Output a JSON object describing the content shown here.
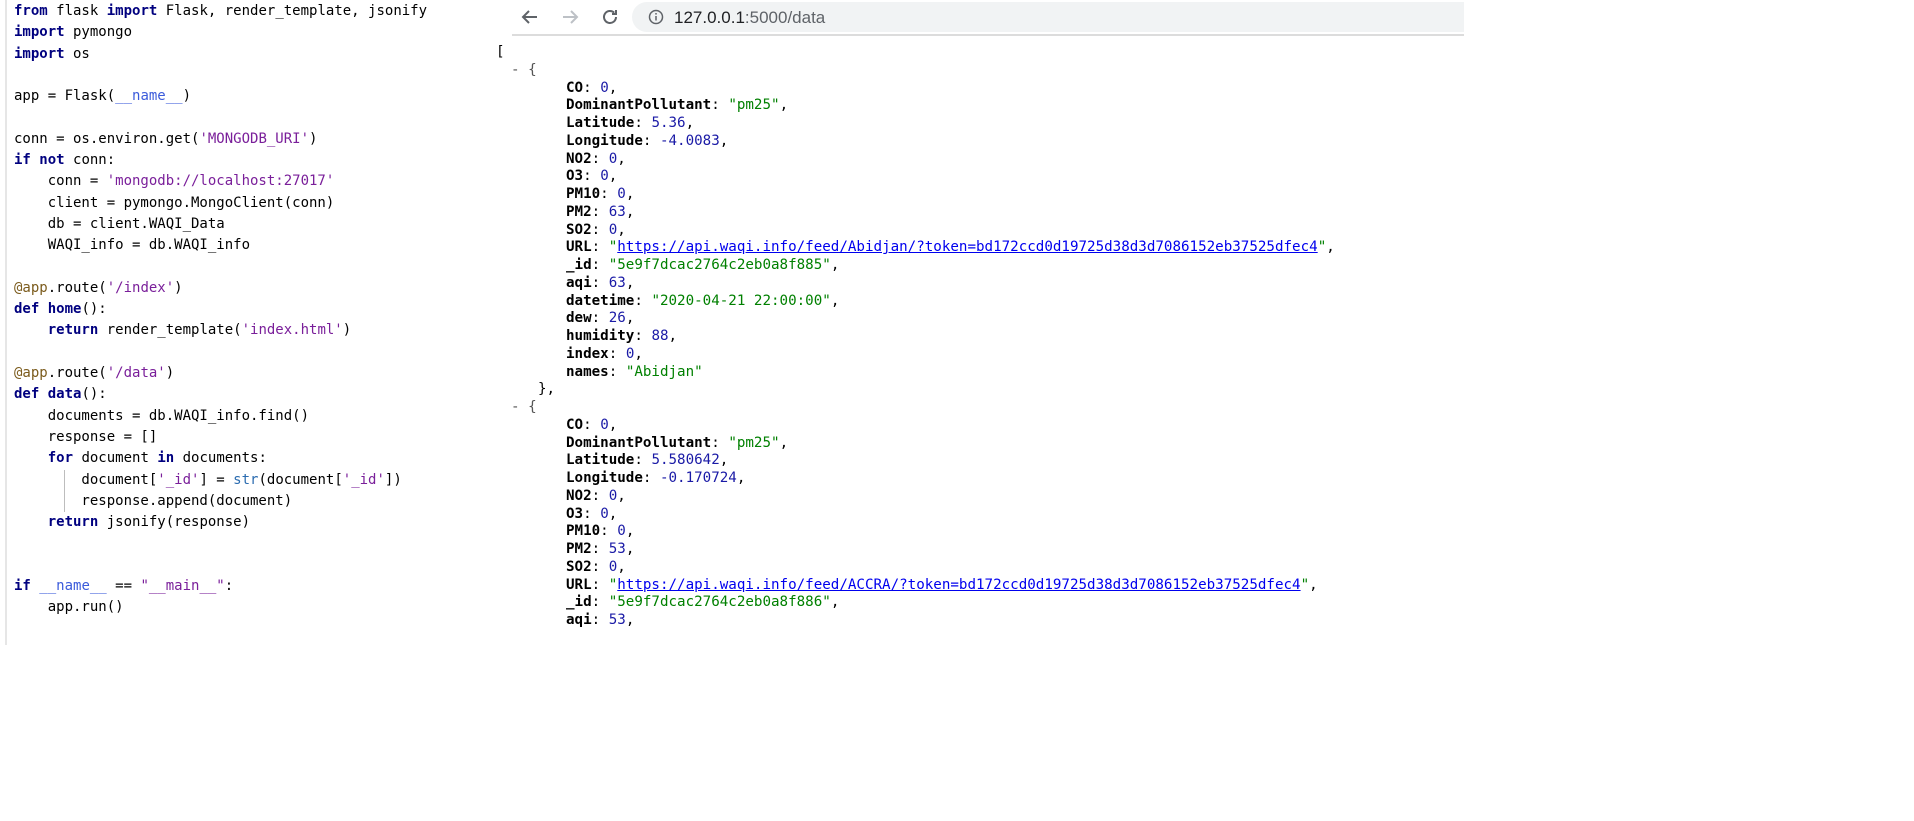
{
  "editor": {
    "lines": [
      [
        {
          "t": "from",
          "c": "kw2"
        },
        {
          "t": " flask "
        },
        {
          "t": "import",
          "c": "kw2"
        },
        {
          "t": " Flask, render_template, jsonify"
        }
      ],
      [
        {
          "t": "import",
          "c": "kw2"
        },
        {
          "t": " pymongo"
        }
      ],
      [
        {
          "t": "import",
          "c": "kw2"
        },
        {
          "t": " os"
        }
      ],
      [],
      [
        {
          "t": "app = Flask("
        },
        {
          "t": "__name__",
          "c": "dunder"
        },
        {
          "t": ")"
        }
      ],
      [],
      [
        {
          "t": "conn = os.environ.get("
        },
        {
          "t": "'MONGODB_URI'",
          "c": "strp"
        },
        {
          "t": ")"
        }
      ],
      [
        {
          "t": "if",
          "c": "kw2"
        },
        {
          "t": " "
        },
        {
          "t": "not",
          "c": "kw2"
        },
        {
          "t": " conn:"
        }
      ],
      [
        {
          "t": "    conn = "
        },
        {
          "t": "'mongodb://localhost:27017'",
          "c": "strp"
        }
      ],
      [
        {
          "t": "    client = pymongo.MongoClient(conn)"
        }
      ],
      [
        {
          "t": "    db = client.WAQI_Data"
        }
      ],
      [
        {
          "t": "    WAQI_info = db.WAQI_info"
        }
      ],
      [],
      [
        {
          "t": "@app",
          "c": "dec"
        },
        {
          "t": ".route("
        },
        {
          "t": "'/index'",
          "c": "strp"
        },
        {
          "t": ")"
        }
      ],
      [
        {
          "t": "def",
          "c": "kw2"
        },
        {
          "t": " "
        },
        {
          "t": "home",
          "c": "fn"
        },
        {
          "t": "():"
        }
      ],
      [
        {
          "t": "    "
        },
        {
          "t": "return",
          "c": "kw2"
        },
        {
          "t": " render_template("
        },
        {
          "t": "'index.html'",
          "c": "strp"
        },
        {
          "t": ")"
        }
      ],
      [],
      [
        {
          "t": "@app",
          "c": "dec"
        },
        {
          "t": ".route("
        },
        {
          "t": "'/data'",
          "c": "strp"
        },
        {
          "t": ")"
        }
      ],
      [
        {
          "t": "def",
          "c": "kw2"
        },
        {
          "t": " "
        },
        {
          "t": "data",
          "c": "fn"
        },
        {
          "t": "():"
        }
      ],
      [
        {
          "t": "    documents = db.WAQI_info.find()"
        }
      ],
      [
        {
          "t": "    response = []"
        }
      ],
      [
        {
          "t": "    "
        },
        {
          "t": "for",
          "c": "kw2"
        },
        {
          "t": " document "
        },
        {
          "t": "in",
          "c": "kw2"
        },
        {
          "t": " documents:"
        }
      ],
      [
        {
          "t": "        document["
        },
        {
          "t": "'_id'",
          "c": "strp"
        },
        {
          "t": "] = "
        },
        {
          "t": "str",
          "c": "builtin"
        },
        {
          "t": "(document["
        },
        {
          "t": "'_id'",
          "c": "strp"
        },
        {
          "t": "])"
        }
      ],
      [
        {
          "t": "        response.append(document)"
        }
      ],
      [
        {
          "t": "    "
        },
        {
          "t": "return",
          "c": "kw2"
        },
        {
          "t": " jsonify(response)"
        }
      ],
      [],
      [],
      [
        {
          "t": "if",
          "c": "kw2"
        },
        {
          "t": " "
        },
        {
          "t": "__name__",
          "c": "dunder"
        },
        {
          "t": " == "
        },
        {
          "t": "\"__main__\"",
          "c": "strp"
        },
        {
          "t": ":"
        }
      ],
      [
        {
          "t": "    app.run()"
        }
      ]
    ]
  },
  "browser": {
    "url_host": "127.0.0.1",
    "url_path": ":5000/data",
    "back_icon": "arrow-left-icon",
    "forward_icon": "arrow-right-icon",
    "reload_icon": "reload-icon",
    "info_icon": "info-icon"
  },
  "json_view": {
    "open_bracket": "[",
    "collapse_toggle": "- {",
    "close_brace": "},",
    "records": [
      {
        "fields": [
          {
            "key": "CO",
            "value": "0",
            "type": "num"
          },
          {
            "key": "DominantPollutant",
            "value": "\"pm25\"",
            "type": "str"
          },
          {
            "key": "Latitude",
            "value": "5.36",
            "type": "num"
          },
          {
            "key": "Longitude",
            "value": "-4.0083",
            "type": "num"
          },
          {
            "key": "NO2",
            "value": "0",
            "type": "num"
          },
          {
            "key": "O3",
            "value": "0",
            "type": "num"
          },
          {
            "key": "PM10",
            "value": "0",
            "type": "num"
          },
          {
            "key": "PM2",
            "value": "63",
            "type": "num"
          },
          {
            "key": "SO2",
            "value": "0",
            "type": "num"
          },
          {
            "key": "URL",
            "value": "https://api.waqi.info/feed/Abidjan/?token=bd172ccd0d19725d38d3d7086152eb37525dfec4",
            "type": "url"
          },
          {
            "key": "_id",
            "value": "\"5e9f7dcac2764c2eb0a8f885\"",
            "type": "str"
          },
          {
            "key": "aqi",
            "value": "63",
            "type": "num"
          },
          {
            "key": "datetime",
            "value": "\"2020-04-21 22:00:00\"",
            "type": "str"
          },
          {
            "key": "dew",
            "value": "26",
            "type": "num"
          },
          {
            "key": "humidity",
            "value": "88",
            "type": "num"
          },
          {
            "key": "index",
            "value": "0",
            "type": "num"
          },
          {
            "key": "names",
            "value": "\"Abidjan\"",
            "type": "str",
            "last": true
          }
        ],
        "closed": true
      },
      {
        "fields": [
          {
            "key": "CO",
            "value": "0",
            "type": "num"
          },
          {
            "key": "DominantPollutant",
            "value": "\"pm25\"",
            "type": "str"
          },
          {
            "key": "Latitude",
            "value": "5.580642",
            "type": "num"
          },
          {
            "key": "Longitude",
            "value": "-0.170724",
            "type": "num"
          },
          {
            "key": "NO2",
            "value": "0",
            "type": "num"
          },
          {
            "key": "O3",
            "value": "0",
            "type": "num"
          },
          {
            "key": "PM10",
            "value": "0",
            "type": "num"
          },
          {
            "key": "PM2",
            "value": "53",
            "type": "num"
          },
          {
            "key": "SO2",
            "value": "0",
            "type": "num"
          },
          {
            "key": "URL",
            "value": "https://api.waqi.info/feed/ACCRA/?token=bd172ccd0d19725d38d3d7086152eb37525dfec4",
            "type": "url"
          },
          {
            "key": "_id",
            "value": "\"5e9f7dcac2764c2eb0a8f886\"",
            "type": "str"
          },
          {
            "key": "aqi",
            "value": "53",
            "type": "num"
          }
        ],
        "closed": false
      }
    ]
  },
  "colors": {
    "json_number": "#1a1aa6",
    "json_string": "#008000",
    "json_link": "#0000ee",
    "omnibox_bg": "#f1f3f4"
  }
}
